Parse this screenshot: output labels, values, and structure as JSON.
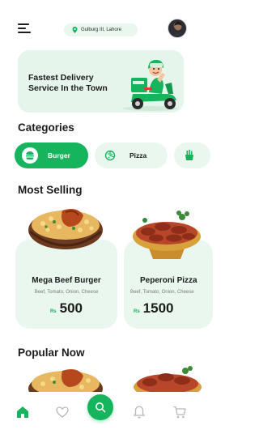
{
  "header": {
    "menu_icon": "hamburger-menu-icon",
    "location": {
      "icon": "location-pin-icon",
      "text": "Gulburg III, Lahore"
    },
    "avatar_icon": "user-avatar"
  },
  "promo": {
    "line1": "Fastest Delivery",
    "line2": "Service In the Town",
    "art_icon": "delivery-scooter-illustration"
  },
  "categories": {
    "title": "Categories",
    "items": [
      {
        "label": "Burger",
        "icon": "burger-icon",
        "selected": true
      },
      {
        "label": "Pizza",
        "icon": "pizza-icon",
        "selected": false
      },
      {
        "label": "",
        "icon": "fries-icon",
        "selected": false
      }
    ]
  },
  "most_selling": {
    "title": "Most Selling",
    "items": [
      {
        "name": "Mega Beef Burger",
        "desc": "Beef, Tomato, Onion, Cheese",
        "currency": "Rs",
        "price": "500",
        "image": "biryani-bowl-image"
      },
      {
        "name": "Peperoni Pizza",
        "desc": "Beef, Tomato, Onion, Cheese",
        "currency": "Rs",
        "price": "1500",
        "image": "kebab-platter-image"
      }
    ]
  },
  "popular_now": {
    "title": "Popular Now"
  },
  "bottom_nav": {
    "items": [
      "home-icon",
      "heart-icon",
      "search-icon",
      "bell-icon",
      "cart-icon"
    ],
    "active": "home-icon"
  },
  "colors": {
    "accent": "#16b55d",
    "accent_light": "#e9f7ef",
    "text": "#1c1c1c",
    "muted": "#7a7a7a"
  }
}
